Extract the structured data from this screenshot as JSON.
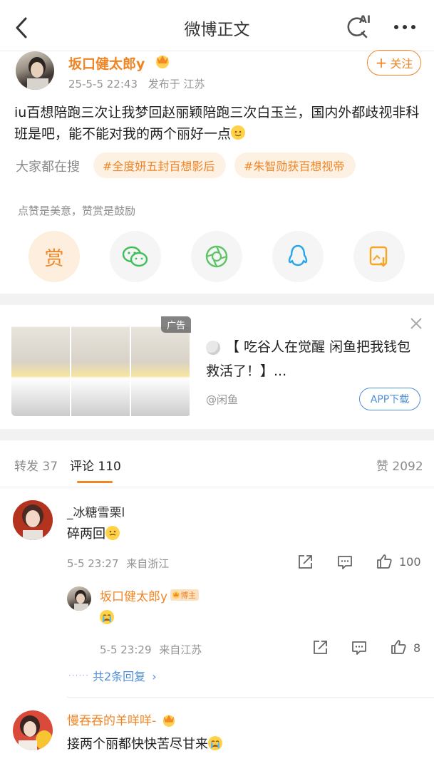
{
  "nav": {
    "title": "微博正文",
    "ai_label": "AI"
  },
  "post": {
    "author": "坂口健太郎y",
    "timestamp": "25-5-5 22:43",
    "location": "发布于 江苏",
    "follow_label": "关注",
    "text": "iu百想陪跑三次让我梦回赵丽颖陪跑三次白玉兰，国内外都歧视非科班是吧，能不能对我的两个丽好一点",
    "search_label": "大家都在搜",
    "tags": [
      "#全度妍五封百想影后",
      "#朱智勋获百想视帝"
    ],
    "reward_text": "点赞是美意，赞赏是鼓励",
    "reward_label": "赏"
  },
  "ad": {
    "badge": "广告",
    "title": "【 吃谷人在觉醒 闲鱼把我钱包救活了！】...",
    "source": "@闲鱼",
    "download_label": "APP下载"
  },
  "tabs": {
    "repost": "转发 37",
    "comments": "评论 110",
    "likes": "赞 2092"
  },
  "comments": [
    {
      "name": "_冰糖雪栗l",
      "text": "碎两回",
      "time": "5-5 23:27",
      "location": "来自浙江",
      "likes": "100",
      "reply": {
        "name": "坂口健太郎y",
        "badge": "博主",
        "time": "5-5 23:29",
        "location": "来自江苏",
        "likes": "8"
      },
      "more_replies": "共2条回复"
    },
    {
      "name": "慢吞吞的羊咩咩-",
      "text": "接两个丽都快快苦尽甘来"
    }
  ],
  "colors": {
    "accent": "#f08526",
    "link": "#4d8fd9"
  }
}
